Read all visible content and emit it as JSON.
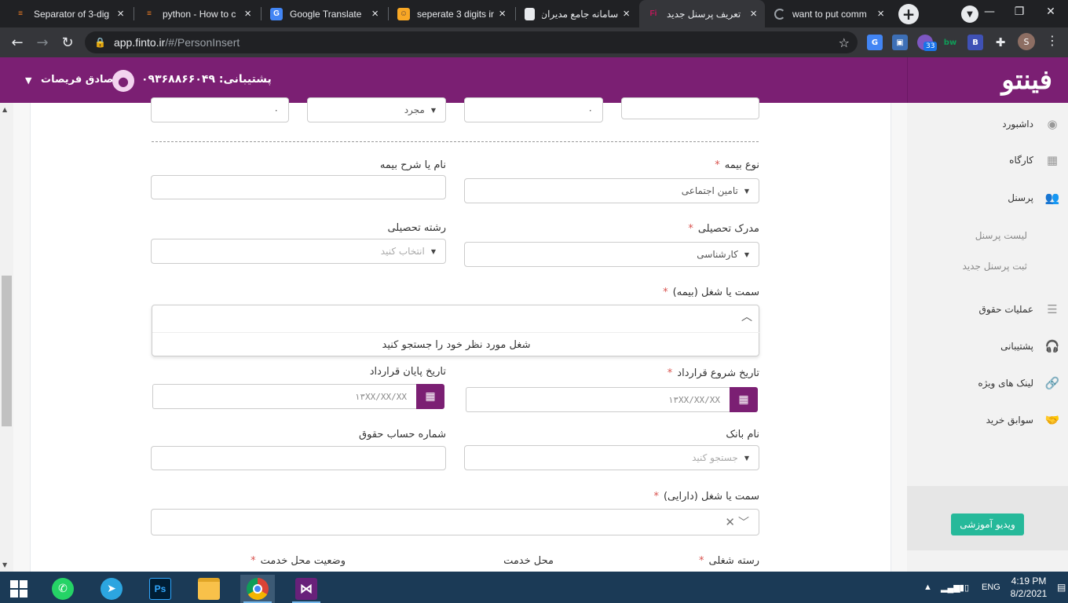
{
  "browser": {
    "tabs": [
      {
        "title": "Separator of 3-dig",
        "fav": "stackoverflow-icon",
        "favColor": "#f48024",
        "favChar": "≡"
      },
      {
        "title": "python - How to c",
        "fav": "stackoverflow-icon",
        "favColor": "#f48024",
        "favChar": "≡"
      },
      {
        "title": "Google Translate",
        "fav": "google-translate-icon",
        "favColor": "#4285f4",
        "favChar": "G"
      },
      {
        "title": "seperate 3 digits in",
        "fav": "tutorial-icon",
        "favColor": "#f9a825",
        "favChar": "☺"
      },
      {
        "title": "سامانه جامع مدیران",
        "fav": "document-icon",
        "favColor": "#e8eaed",
        "favChar": ""
      },
      {
        "title": "تعریف پرسنل جدید",
        "fav": "finto-icon",
        "favColor": "#35363a",
        "favChar": "Fi"
      },
      {
        "title": "want to put comm",
        "fav": "loading-icon",
        "favColor": "#202124",
        "favChar": "◌"
      }
    ],
    "url_host": "app.finto.ir",
    "url_path": "/#/PersonInsert",
    "ext_badge": "33",
    "profile_initial": "S",
    "ext_bw": "bw",
    "ext_b": "B"
  },
  "header": {
    "logo": "فینتو",
    "support": "پشتیبانی: ۰۹۳۶۸۸۶۶۰۴۹",
    "username": "صادق فریصات"
  },
  "sidebar": {
    "items": [
      {
        "label": "داشبورد",
        "icon": "dashboard-icon",
        "glyph": "◉"
      },
      {
        "label": "کارگاه",
        "icon": "building-icon",
        "glyph": "▦"
      },
      {
        "label": "پرسنل",
        "icon": "users-icon",
        "glyph": "👥"
      },
      {
        "label": "عملیات حقوق",
        "icon": "coins-icon",
        "glyph": "☰"
      },
      {
        "label": "پشتیبانی",
        "icon": "headset-icon",
        "glyph": "🎧"
      },
      {
        "label": "لینک های ویژه",
        "icon": "link-icon",
        "glyph": "🔗"
      },
      {
        "label": "سوابق خرید",
        "icon": "handshake-icon",
        "glyph": "🤝"
      }
    ],
    "sub": [
      "لیست پرسنل",
      "ثبت پرسنل جدید"
    ],
    "video_button": "ویدیو آموزشی"
  },
  "form": {
    "top_row": {
      "f1": "۰",
      "f2": "مجرد",
      "f3": "۰"
    },
    "insurance_type_label": "نوع بیمه",
    "insurance_type_value": "تامین اجتماعی",
    "insurance_name_label": "نام یا شرح بیمه",
    "education_label": "مدرک تحصیلی",
    "education_value": "کارشناسی",
    "major_label": "رشته تحصیلی",
    "major_placeholder": "انتخاب کنید",
    "job_insurance_label": "سمت یا شغل (بیمه)",
    "job_insurance_msg": "شغل مورد نظر خود را جستجو کنید",
    "start_label": "تاریخ شروع قرارداد",
    "end_label": "تاریخ پایان قرارداد",
    "date_placeholder": "۱۳XX/XX/XX",
    "bank_label": "نام بانک",
    "bank_placeholder": "جستجو کنید",
    "account_label": "شماره حساب حقوق",
    "job_tax_label": "سمت یا شغل (دارایی)",
    "job_category_label": "رسته شغلی",
    "service_place_label": "محل خدمت",
    "service_status_label": "وضعیت محل خدمت",
    "required_mark": "*"
  },
  "taskbar": {
    "lang": "ENG",
    "time": "4:19 PM",
    "date": "8/2/2021",
    "ps_label": "Ps"
  }
}
